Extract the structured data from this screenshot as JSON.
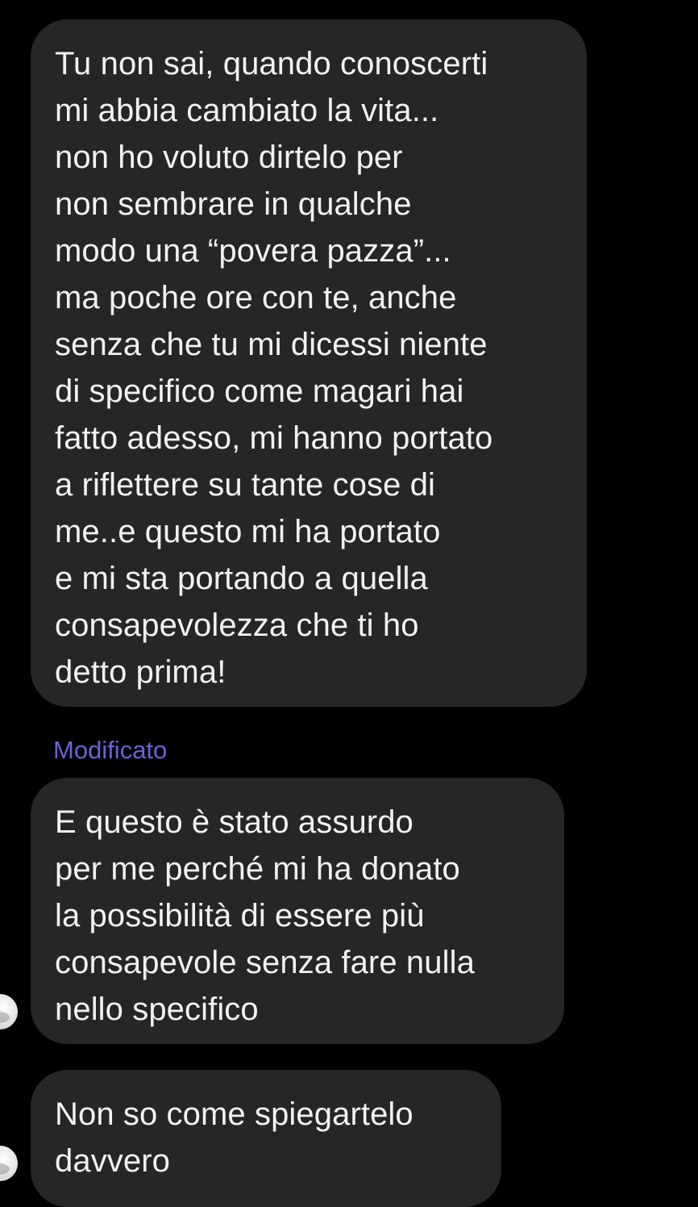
{
  "messages": [
    {
      "lines": [
        "Tu non sai, quando conoscerti",
        "mi abbia cambiato la vita...",
        "non ho voluto dirtelo per",
        "non sembrare in qualche",
        "modo una “povera pazza”...",
        "ma poche ore con te, anche",
        "senza che tu mi dicessi niente",
        "di specifico come magari hai",
        "fatto adesso, mi hanno portato",
        "a riflettere su tante cose di",
        "me..e questo mi ha portato",
        "e mi sta portando a quella",
        "consapevolezza che ti ho",
        "detto prima!"
      ]
    },
    {
      "lines": [
        "E questo è stato assurdo",
        "per me perché mi ha donato",
        "la possibilità di essere più",
        "consapevole senza fare nulla",
        "nello specifico"
      ]
    },
    {
      "lines": [
        "Non so come spiegartelo",
        "davvero"
      ]
    }
  ],
  "edited_label": "Modificato",
  "colors": {
    "background": "#000000",
    "bubble": "#262626",
    "text": "#f2f2f2",
    "edited_label": "#6a63d6"
  },
  "icons": {
    "sender_avatar": "avatar-icon"
  }
}
